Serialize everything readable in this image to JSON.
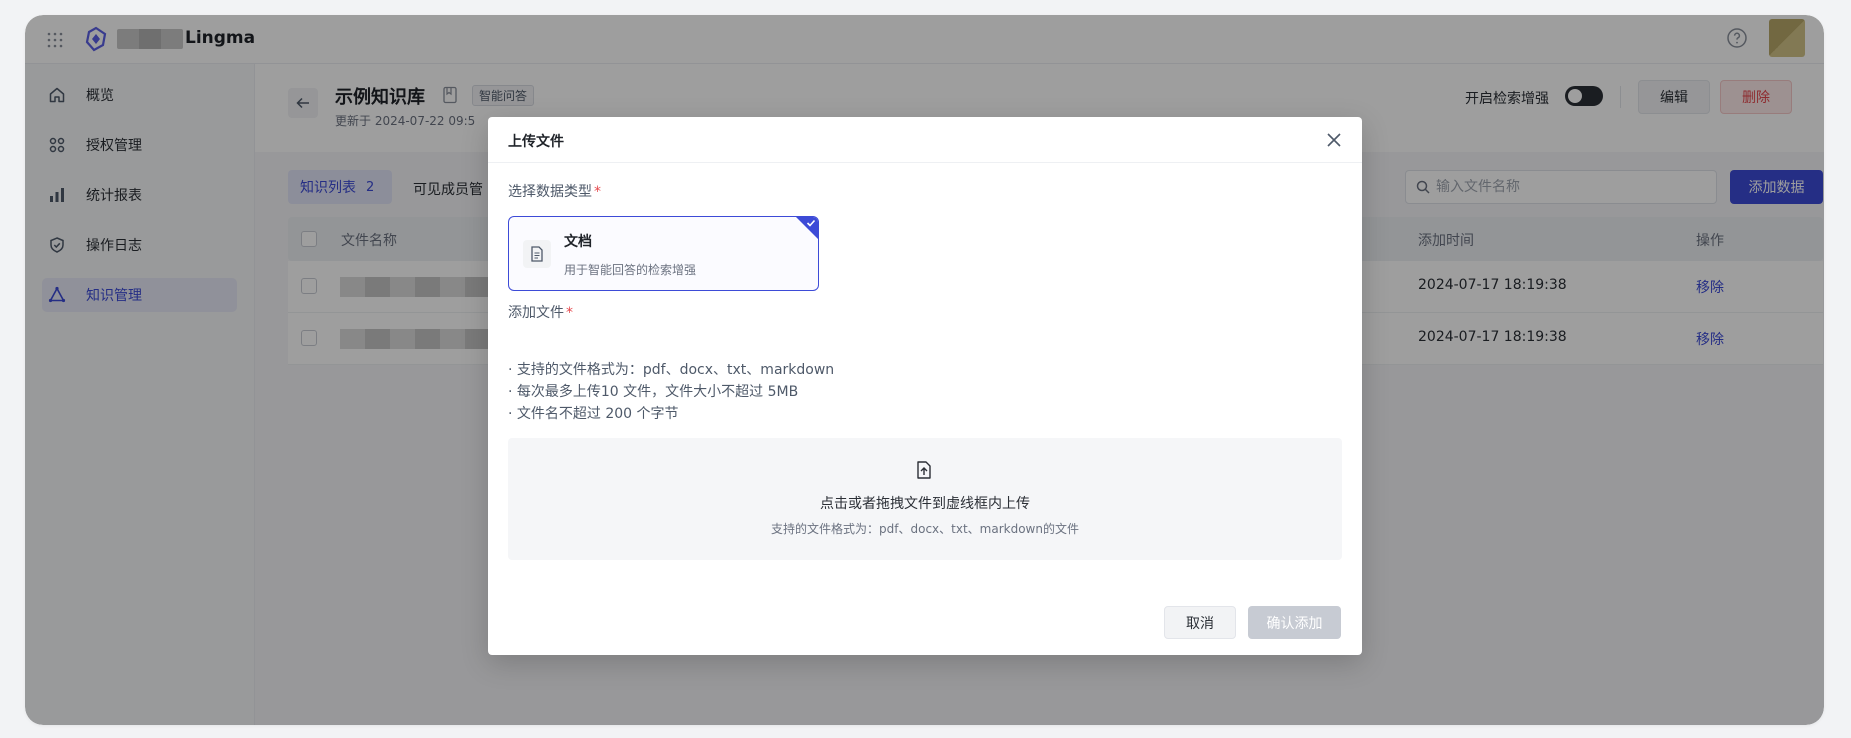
{
  "topbar": {
    "brand_name": "Lingma",
    "icons": {
      "grid": "grid-icon",
      "logo": "logo-icon",
      "help": "help-icon"
    }
  },
  "sidebar": {
    "items": [
      {
        "label": "概览",
        "icon": "home-icon",
        "active": false
      },
      {
        "label": "授权管理",
        "icon": "apps-icon",
        "active": false
      },
      {
        "label": "统计报表",
        "icon": "bar-chart-icon",
        "active": false
      },
      {
        "label": "操作日志",
        "icon": "shield-icon",
        "active": false
      },
      {
        "label": "知识管理",
        "icon": "triangle-nodes-icon",
        "active": true
      }
    ]
  },
  "main": {
    "title": "示例知识库",
    "tag": "智能问答",
    "meta": "更新于 2024-07-22 09:5",
    "toggle_label": "开启检索增强",
    "toggle_on": true,
    "edit_label": "编辑",
    "delete_label": "删除",
    "tabs": [
      {
        "label": "知识列表",
        "count": "2"
      },
      {
        "label": "可见成员管"
      }
    ],
    "search_placeholder": "输入文件名称",
    "add_label": "添加数据",
    "table": {
      "headers": {
        "name": "文件名称",
        "time": "添加时间",
        "op": "操作"
      },
      "rows": [
        {
          "time": "2024-07-17 18:19:38",
          "op": "移除"
        },
        {
          "time": "2024-07-17 18:19:38",
          "op": "移除"
        }
      ]
    }
  },
  "modal": {
    "title": "上传文件",
    "type_label": "选择数据类型",
    "required_mark": "*",
    "type_card": {
      "name": "文档",
      "desc": "用于智能回答的检索增强"
    },
    "file_label": "添加文件",
    "rules": [
      "· 支持的文件格式为：pdf、docx、txt、markdown",
      "· 每次最多上传10 文件，文件大小不超过 5MB",
      "· 文件名不超过 200 个字节"
    ],
    "drop_main": "点击或者拖拽文件到虚线框内上传",
    "drop_sub": "支持的文件格式为：pdf、docx、txt、markdown的文件",
    "cancel_label": "取消",
    "confirm_label": "确认添加"
  },
  "colors": {
    "accent": "#3d4bd7",
    "danger": "#e5484d",
    "disabled": "#c7cbd3"
  }
}
